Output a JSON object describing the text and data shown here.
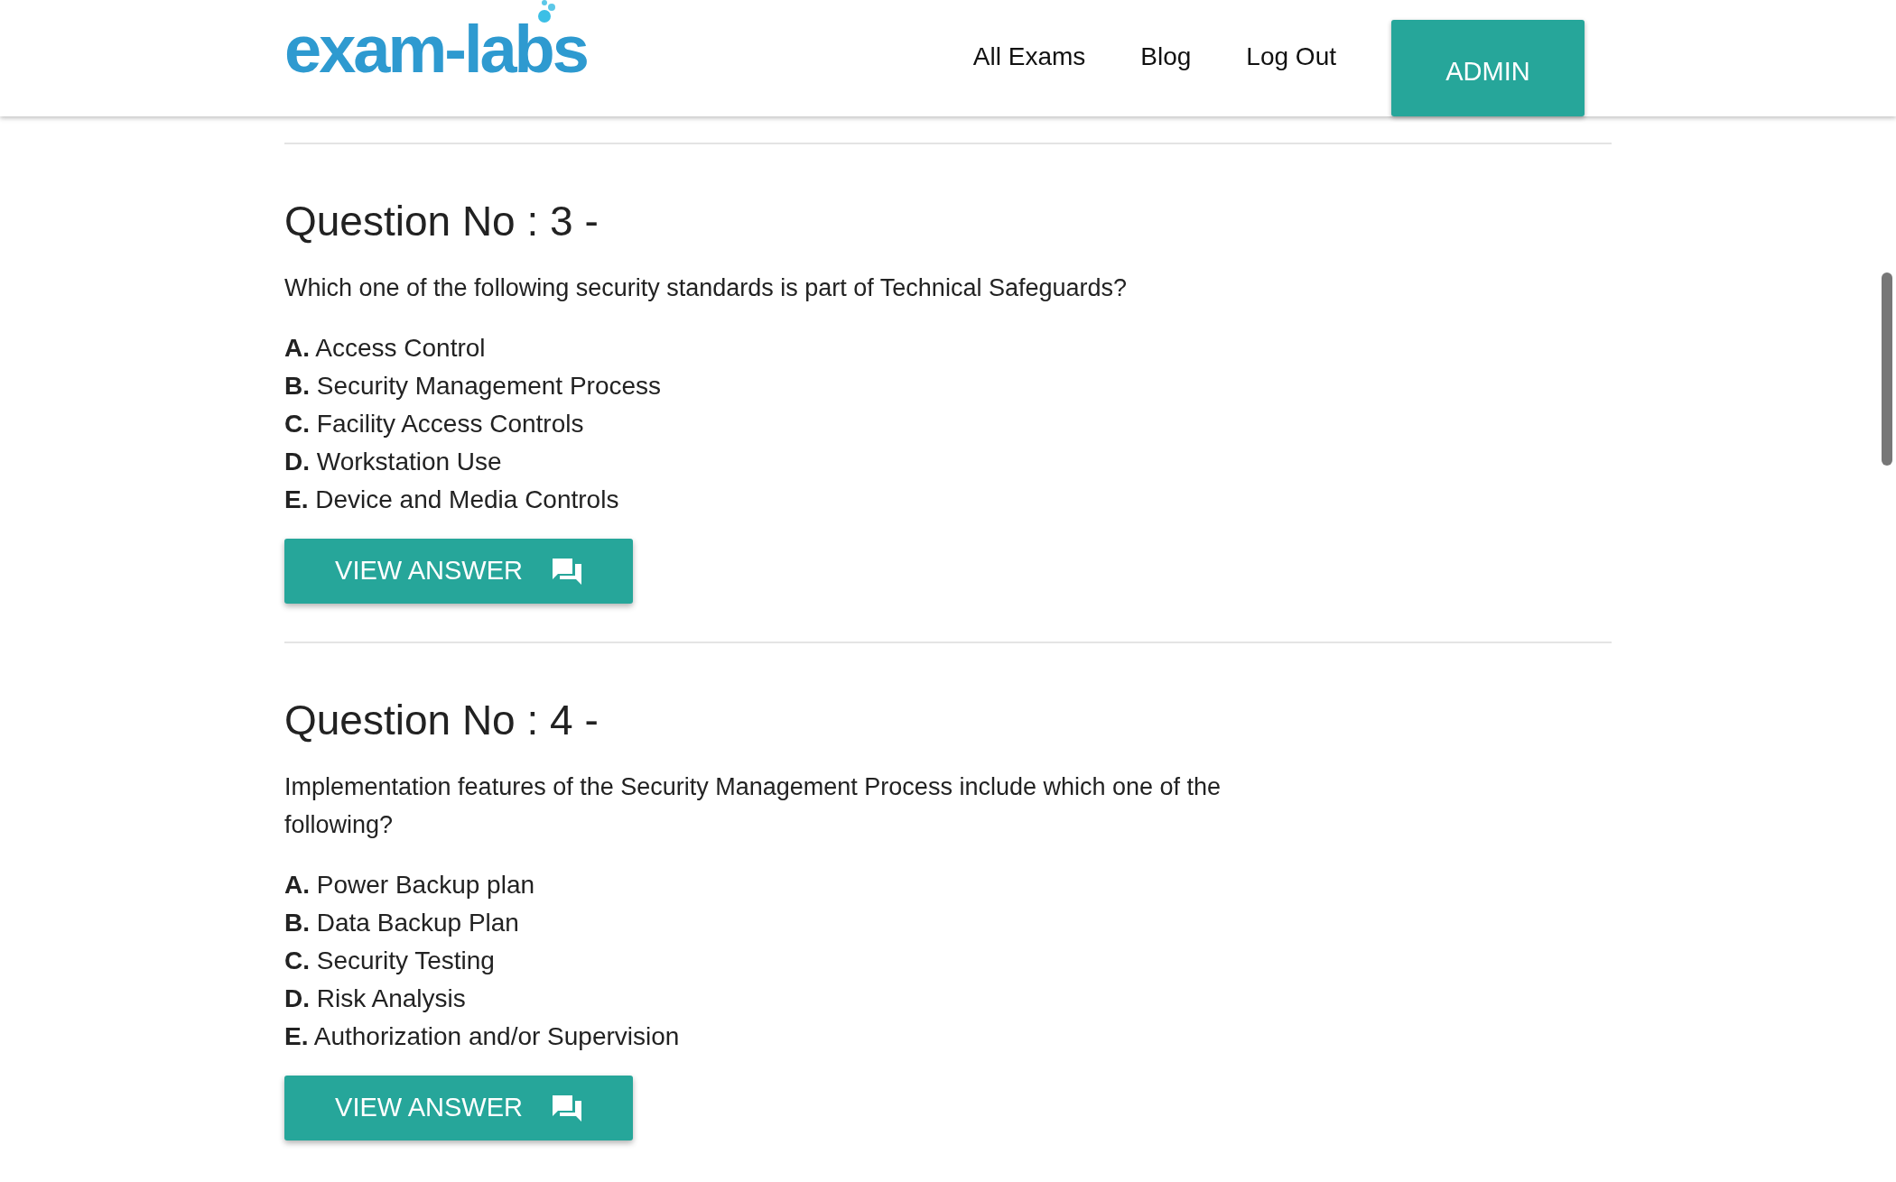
{
  "header": {
    "logo": "exam-labs",
    "nav": [
      "All Exams",
      "Blog",
      "Log Out"
    ],
    "admin_button": "ADMIN"
  },
  "questions": [
    {
      "title": "Question No : 3 -",
      "text": "Which one of the following security standards is part of Technical Safeguards?",
      "options": [
        {
          "letter": "A.",
          "text": "Access Control"
        },
        {
          "letter": "B.",
          "text": "Security Management Process"
        },
        {
          "letter": "C.",
          "text": "Facility Access Controls"
        },
        {
          "letter": "D.",
          "text": "Workstation Use"
        },
        {
          "letter": "E.",
          "text": "Device and Media Controls"
        }
      ],
      "button": "VIEW ANSWER"
    },
    {
      "title": "Question No : 4 -",
      "text": "Implementation features of the Security Management Process include which one of the following?",
      "options": [
        {
          "letter": "A.",
          "text": "Power Backup plan"
        },
        {
          "letter": "B.",
          "text": "Data Backup Plan"
        },
        {
          "letter": "C.",
          "text": "Security Testing"
        },
        {
          "letter": "D.",
          "text": "Risk Analysis"
        },
        {
          "letter": "E.",
          "text": "Authorization and/or Supervision"
        }
      ],
      "button": "VIEW ANSWER"
    }
  ]
}
